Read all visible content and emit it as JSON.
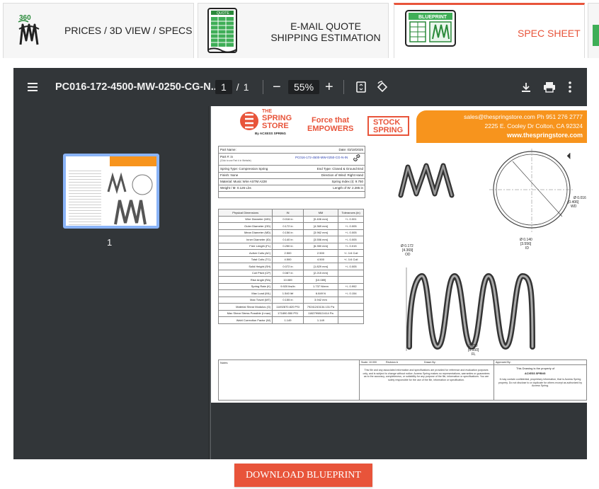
{
  "tabs": [
    {
      "label": "PRICES / 3D VIEW / SPECS",
      "icon": "spring-360-icon"
    },
    {
      "label_line1": "E-MAIL QUOTE",
      "label_line2": "SHIPPING ESTIMATION",
      "icon": "quote-sheet-icon",
      "icon_caption": "QUOTE"
    },
    {
      "label": "SPEC SHEET",
      "icon": "blueprint-icon",
      "icon_caption": "BLUEPRINT",
      "active": true
    }
  ],
  "viewer": {
    "file_name": "PC016-172-4500-MW-0250-CG-N...",
    "page_current": "1",
    "page_separator": "/",
    "page_total": "1",
    "zoom": "55%",
    "thumbnail_label": "1"
  },
  "sheet": {
    "logo_line1": "THE",
    "logo_line2": "SPRING",
    "logo_line3": "STORE",
    "logo_sub": "By ACXESS SPRING",
    "tagline_line1": "Force that",
    "tagline_line2": "EMPOWERS",
    "stock_line1": "STOCK",
    "stock_line2": "SPRING",
    "contact_line1": "sales@thespringstore.com  Ph 951 276 2777",
    "contact_line2": "2225 E. Cooley Dr Colton, CA 92324",
    "contact_line3": "www.thespringstore.com",
    "part_name_label": "Part Name:",
    "date_label": "Date: 03/18/2025",
    "part_no_label": "Part #: in",
    "part_no_sub": "(Click to use Part # in Website)",
    "part_no_value": "PC016-172-4500-MW-0250-CG-N-IN",
    "spring_type": "Spring Type: Compression Spring",
    "end_type": "End Type: Closed & Ground End",
    "finish": "Finish: None",
    "direction": "Direction of Wind: Right Hand",
    "material": "Material: Music Wire ASTM A228",
    "spring_index": "Spring Index (I): 9.750",
    "weight": "Weight / M: 0.126 Lbs",
    "length_wire": "Length of W: 2.285 in",
    "table_headers": [
      "Physical Dimensions",
      "IN",
      "MM",
      "Tolerances (in)"
    ],
    "table_rows": [
      [
        "Wire Diameter (WD)",
        "0.016 in",
        "[0.406 mm]",
        "+/- 0.001"
      ],
      [
        "Outer Diameter (OD)",
        "0.172 in",
        "[4.369 mm]",
        "+/- 0.005"
      ],
      [
        "Mean Diameter (MD)",
        "0.156 in",
        "[3.962 mm]",
        "+/- 0.005"
      ],
      [
        "Inner Diameter (ID)",
        "0.140 in",
        "[3.556 mm]",
        "+/- 0.005"
      ],
      [
        "Free Length (FL)",
        "0.250 in",
        "[6.350 mm]",
        "+/- 0.015"
      ],
      [
        "Active Coils (AC)",
        "2.500",
        "2.500",
        "+/- 1/4 Coil"
      ],
      [
        "Total Coils (TC)",
        "4.500",
        "4.500",
        "+/- 1/4 Coil"
      ],
      [
        "Solid Height (SH)",
        "0.072 in",
        "[1.829 mm]",
        "+/- 0.005"
      ],
      [
        "Coil Pitch (CP)",
        "0.087 in",
        "[2.215 mm]",
        ""
      ],
      [
        "Rise Angle (RA)",
        "10.089",
        "[10.089]",
        ""
      ],
      [
        "Spring Rate (K)",
        "9.920 lbs/in",
        "1.737 N/mm",
        "+/- 0.992"
      ],
      [
        "Max Load (ML)",
        "1.540 lbf",
        "6.849 N",
        "+/- 0.154"
      ],
      [
        "Max Travel (MT)",
        "0.155 in",
        "3.942 mm",
        ""
      ],
      [
        "Material Shear Modulus (G)",
        "11492870.820 PSI",
        "79241243134.131 Pa",
        ""
      ],
      [
        "Max Shear Stress Possible (t max)",
        "171890.550 PSI",
        "1182799813.614 Pa",
        ""
      ],
      [
        "Wahl Correction Factor (W)",
        "1.149",
        "1.149",
        ""
      ]
    ],
    "dim_wd": "Ø 0.016",
    "dim_wd_mm": "[0.406]",
    "dim_wd_tag": "WD",
    "dim_id": "Ø 0.140",
    "dim_id_mm": "[3.556]",
    "dim_id_tag": "ID",
    "dim_od": "Ø 0.172",
    "dim_od_mm": "[4.369]",
    "dim_od_tag": "OD",
    "dim_fl": "0.250",
    "dim_fl_mm": "[6.350]",
    "dim_fl_tag": "FL",
    "notes_label": "Notes",
    "scale_label": "Scale: 10.000",
    "revision_label": "Revision A",
    "drawn_label": "Drawn By:",
    "approved_label": "Approved By:",
    "disclaimer": "This file and any associated information and specifications are provided for reference and evaluation purposes only, and is subject to change without notice. Acxess Spring makes no representations, warranties or guarantees as to the accuracy, completeness, or suitability for any purpose of the file, information or specifications. You are solely responsible for the use of the file, information or specification.",
    "property_line": "This Drawing is the property of",
    "property_brand": "ACXESS SPRING",
    "confidential": "It may contain confidential, proprietary information, that is Acxess Spring property. Do not disclose to or duplicate for others except as authorized by Acxess Spring."
  },
  "download_button": "DOWNLOAD BLUEPRINT",
  "colors": {
    "accent": "#e8543a",
    "toolbar": "#323639",
    "viewer_bg": "#525659",
    "sheet_orange": "#f7941d"
  }
}
